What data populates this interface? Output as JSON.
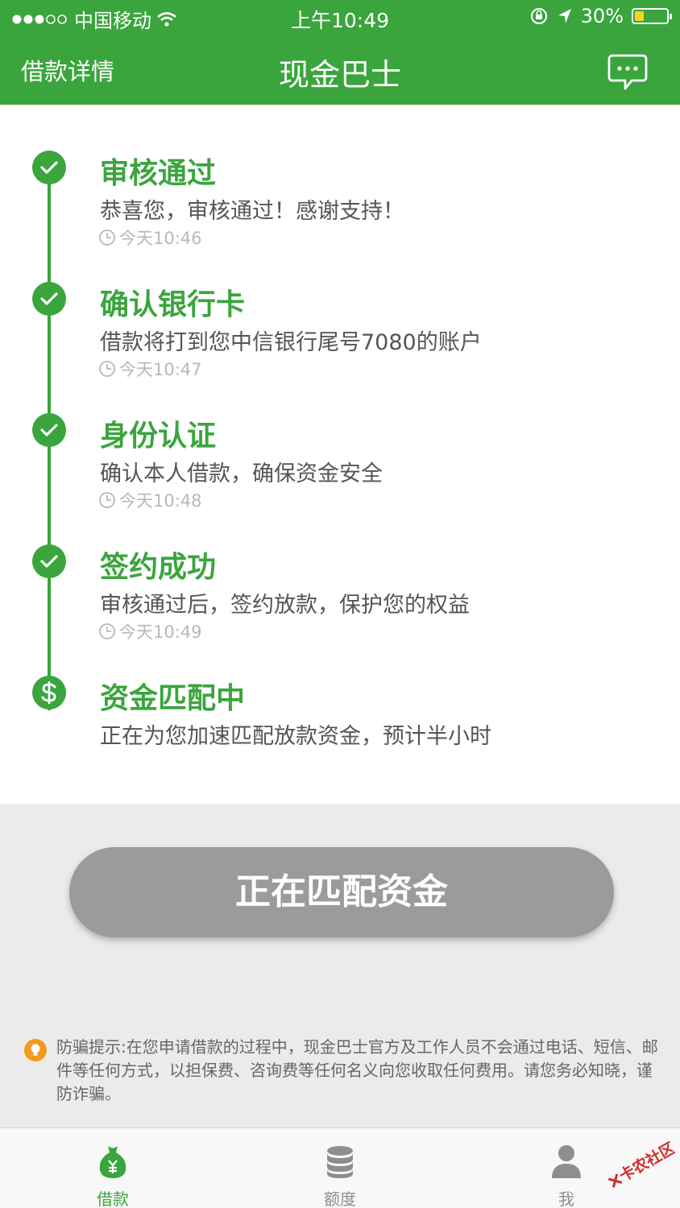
{
  "status_bar": {
    "carrier": "中国移动",
    "time": "上午10:49",
    "battery": "30%",
    "battery_level": 0.3
  },
  "nav": {
    "back_label": "借款详情",
    "title": "现金巴士",
    "message_icon": "chat-bubble-icon"
  },
  "timeline": {
    "steps": [
      {
        "title": "审核通过",
        "desc": "恭喜您，审核通过！感谢支持！",
        "time": "今天10:46",
        "icon": "check-icon"
      },
      {
        "title": "确认银行卡",
        "desc": "借款将打到您中信银行尾号7080的账户",
        "time": "今天10:47",
        "icon": "check-icon"
      },
      {
        "title": "身份认证",
        "desc": "确认本人借款，确保资金安全",
        "time": "今天10:48",
        "icon": "check-icon"
      },
      {
        "title": "签约成功",
        "desc": "审核通过后，签约放款，保护您的权益",
        "time": "今天10:49",
        "icon": "check-icon"
      },
      {
        "title": "资金匹配中",
        "desc": "正在为您加速匹配放款资金，预计半小时",
        "icon": "dollar-icon"
      }
    ]
  },
  "action": {
    "button_label": "正在匹配资金"
  },
  "notice": {
    "text": "防骗提示:在您申请借款的过程中，现金巴士官方及工作人员不会通过电话、短信、邮件等任何方式，以担保费、咨询费等任何名义向您收取任何费用。请您务必知晓，谨防诈骗。"
  },
  "tabs": [
    {
      "label": "借款",
      "icon": "money-bag-icon",
      "active": true
    },
    {
      "label": "额度",
      "icon": "coin-stack-icon",
      "active": false
    },
    {
      "label": "我",
      "icon": "person-icon",
      "active": false
    }
  ],
  "watermark": "卡农社区",
  "colors": {
    "primary": "#3aa53d",
    "button_disabled": "#9b9b9b",
    "notice_icon": "#f39a1b",
    "tab_inactive": "#8e8e8e"
  }
}
